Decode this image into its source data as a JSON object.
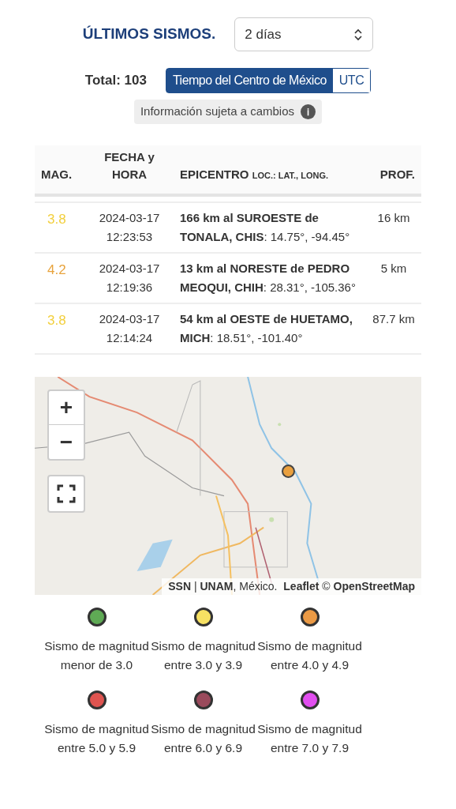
{
  "header": {
    "title": "ÚLTIMOS SISMOS.",
    "period_select": {
      "value": "2 días"
    }
  },
  "total": {
    "label": "Total: 103"
  },
  "time_zone_tabs": [
    {
      "label": "Tiempo del Centro de México",
      "selected": true
    },
    {
      "label": "UTC",
      "selected": false
    }
  ],
  "notice": {
    "text": "Información sujeta a cambios",
    "icon": "ℹ"
  },
  "table": {
    "columns": [
      {
        "label": "MAG."
      },
      {
        "label": "FECHA y HORA"
      },
      {
        "label": "EPICENTRO",
        "sub": "LOC.: LAT., LONG."
      },
      {
        "label": "PROF."
      }
    ],
    "rows": [
      {
        "magnitude": "3.8",
        "color": "#f2cf3c",
        "date": "2024-03-17",
        "time": "12:23:53",
        "place": "166 km al SUROESTE de TONALA, CHIS",
        "coords": ": 14.75°, -94.45°",
        "depth": "16 km"
      },
      {
        "magnitude": "4.2",
        "color": "#e8a33d",
        "date": "2024-03-17",
        "time": "12:19:36",
        "place": "13 km al NORESTE de PEDRO MEOQUI, CHIH",
        "coords": ": 28.31°, -105.36°",
        "depth": "5 km"
      },
      {
        "magnitude": "3.8",
        "color": "#f2cf3c",
        "date": "2024-03-17",
        "time": "12:14:24",
        "place": "54 km al OESTE de HUETAMO, MICH",
        "coords": ": 18.51°, -101.40°",
        "depth": "87.7 km"
      }
    ]
  },
  "map": {
    "zoom_in": "+",
    "zoom_out": "−",
    "marker": {
      "color": "#e9a03f"
    },
    "attribution": "**SSN** | **UNAM**, México.  **Leaflet** © **OpenStreetMap**"
  },
  "legend": [
    {
      "color": "#5faa55",
      "text": "Sismo de magnitud menor de 3.0"
    },
    {
      "color": "#f7e163",
      "text": "Sismo de magnitud entre 3.0 y 3.9"
    },
    {
      "color": "#eb9a45",
      "text": "Sismo de magnitud entre 4.0 y 4.9"
    },
    {
      "color": "#df5450",
      "text": "Sismo de magnitud entre 5.0 y 5.9"
    },
    {
      "color": "#9a4a5c",
      "text": "Sismo de magnitud entre 6.0 y 6.9"
    },
    {
      "color": "#e24ef0",
      "text": "Sismo de magnitud entre 7.0 y 7.9"
    }
  ]
}
